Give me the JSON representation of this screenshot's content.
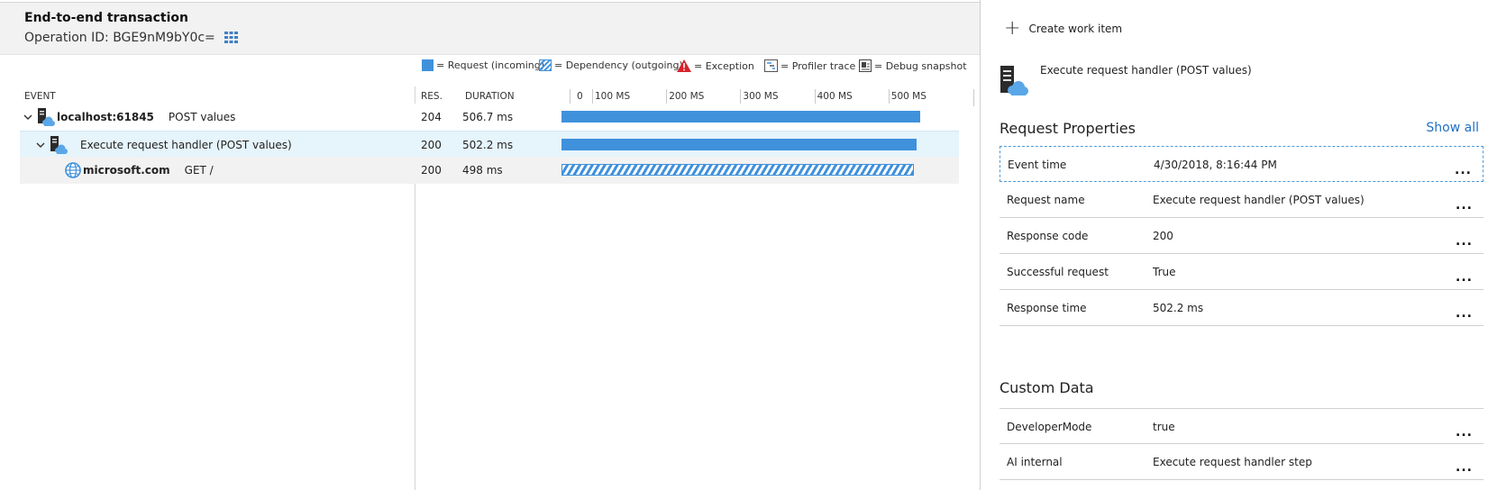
{
  "header": {
    "title": "End-to-end transaction",
    "operation_id": "Operation ID: BGE9nM9bY0c=",
    "grid_icon": "grid-icon"
  },
  "legend": {
    "request": "= Request (incoming)",
    "dependency": "= Dependency (outgoing)",
    "exception": "= Exception",
    "profiler": "= Profiler trace",
    "debug": "= Debug snapshot"
  },
  "columns": {
    "event": "EVENT",
    "res": "RES.",
    "duration": "DURATION"
  },
  "timeline": {
    "ticks": [
      "0",
      "100 MS",
      "200 MS",
      "300 MS",
      "400 MS",
      "500 MS"
    ],
    "max_ms": 506.7
  },
  "rows": [
    {
      "name": "localhost:61845",
      "detail": "POST values",
      "res": "204",
      "duration": "506.7 ms",
      "duration_ms": 506.7,
      "kind": "request",
      "icon": "server-cloud-icon"
    },
    {
      "name": "Execute request handler (POST values)",
      "detail": "",
      "res": "200",
      "duration": "502.2 ms",
      "duration_ms": 502.2,
      "kind": "request",
      "icon": "server-cloud-icon"
    },
    {
      "name": "microsoft.com",
      "detail": "GET /",
      "res": "200",
      "duration": "498 ms",
      "duration_ms": 498,
      "kind": "dependency",
      "icon": "globe-icon"
    }
  ],
  "details": {
    "create_work_item": "Create work item",
    "title": "Execute request handler (POST values)",
    "request_properties_title": "Request Properties",
    "show_all": "Show all",
    "request_properties": [
      {
        "key": "Event time",
        "value": "4/30/2018, 8:16:44 PM"
      },
      {
        "key": "Request name",
        "value": "Execute request handler (POST values)"
      },
      {
        "key": "Response code",
        "value": "200"
      },
      {
        "key": "Successful request",
        "value": "True"
      },
      {
        "key": "Response time",
        "value": "502.2 ms"
      }
    ],
    "custom_data_title": "Custom Data",
    "custom_data": [
      {
        "key": "DeveloperMode",
        "value": "true"
      },
      {
        "key": "AI internal",
        "value": "Execute request handler step"
      }
    ],
    "more_label": "..."
  },
  "colors": {
    "bar": "#3f91dc",
    "selected_row": "#e6f4fb",
    "link": "#1f6fc5"
  }
}
